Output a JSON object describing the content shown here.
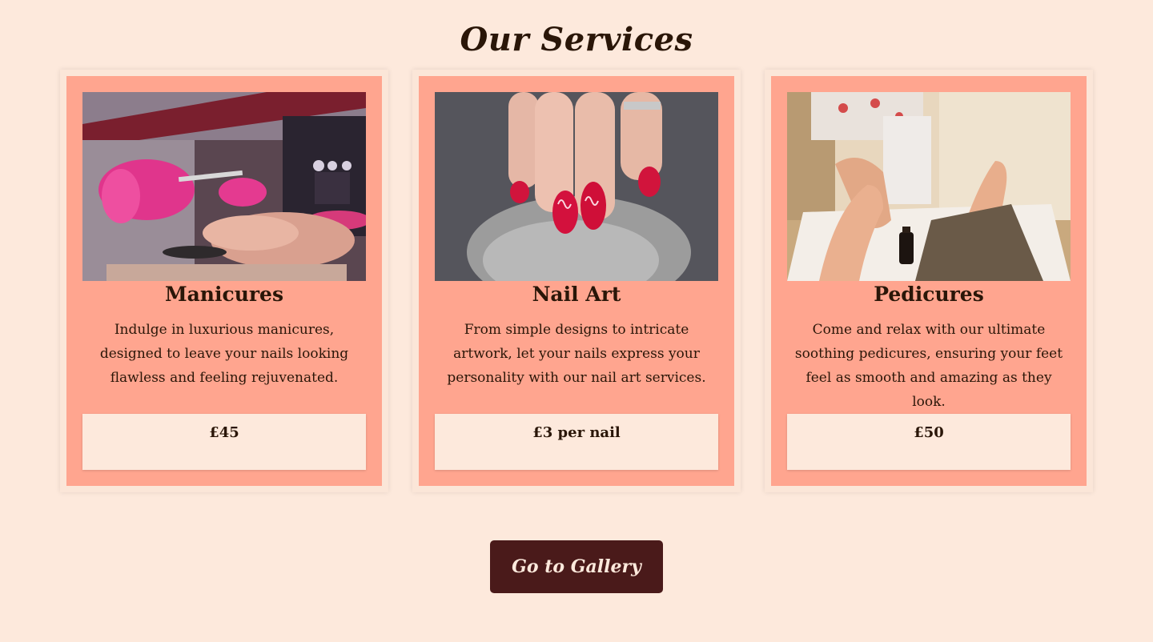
{
  "page": {
    "title": "Our Services",
    "background_color": "#fde9dc"
  },
  "services": [
    {
      "title": "Manicures",
      "description": "Indulge in luxurious manicures, designed to leave your nails looking flawless and feeling rejuvenated.",
      "price": "£45",
      "image_icon": "manicure-photo"
    },
    {
      "title": "Nail Art",
      "description": "From simple designs to intricate artwork, let your nails express your personality with our nail art services.",
      "price": "£3 per nail",
      "image_icon": "nail-art-photo"
    },
    {
      "title": "Pedicures",
      "description": "Come and relax with our ultimate soothing pedicures, ensuring your feet feel as smooth and amazing as they look.",
      "price": "£50",
      "image_icon": "pedicure-photo"
    }
  ],
  "cta": {
    "label": "Go to Gallery"
  },
  "colors": {
    "card_outer": "#fbe6d8",
    "card_inner": "#ffa58f",
    "price_box": "#fde9dc",
    "button": "#4a1a1a",
    "text": "#2a1608"
  }
}
